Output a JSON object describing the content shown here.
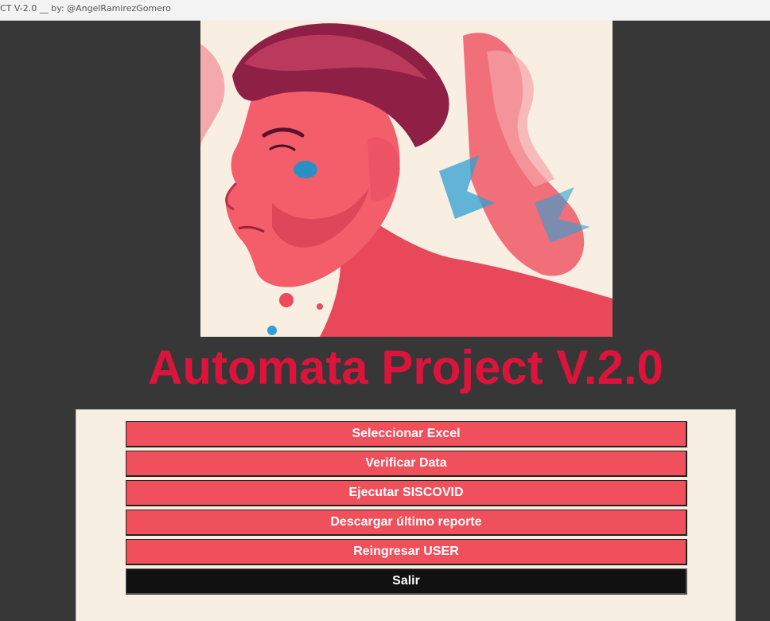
{
  "window": {
    "title": "CT V-2.0 __ by: @AngelRamirezGomero"
  },
  "app": {
    "title": "Automata Project V.2.0",
    "accent_color": "#dc143c",
    "button_color": "#f0505b",
    "exit_color": "#111111"
  },
  "menu": {
    "buttons": [
      {
        "label": "Seleccionar Excel"
      },
      {
        "label": "Verificar Data"
      },
      {
        "label": "Ejecutar SISCOVID"
      },
      {
        "label": "Descargar último reporte"
      },
      {
        "label": "Reingresar USER"
      },
      {
        "label": "Salir"
      }
    ]
  }
}
